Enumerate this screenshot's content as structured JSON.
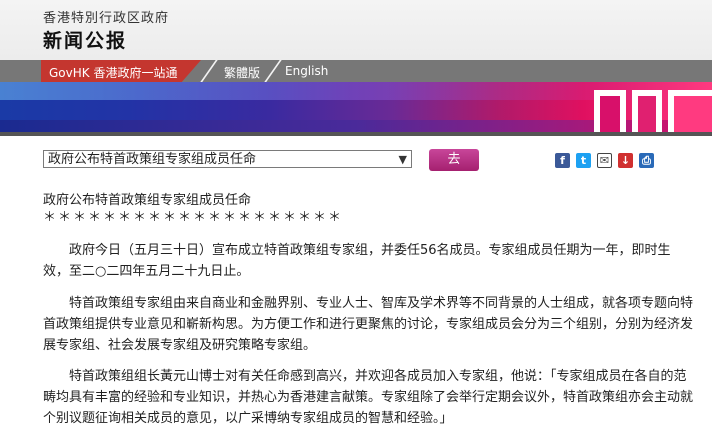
{
  "header": {
    "site_title": "香港特別行政区政府",
    "page_name": "新闻公报"
  },
  "nav": {
    "gov_label": "GovHK 香港政府一站通",
    "traditional_label": "繁體版",
    "english_label": "English"
  },
  "toolbar": {
    "selected_option": "政府公布特首政策组专家组成员任命",
    "go_label": "去",
    "dropdown_arrow": "▼"
  },
  "share": {
    "icons": [
      "facebook-icon",
      "twitter-icon",
      "email-icon",
      "download-icon",
      "print-icon"
    ],
    "colors": {
      "facebook": "#3b5998",
      "twitter": "#1da1f2",
      "email": "#444444",
      "download": "#d03030",
      "print": "#2a6ab8"
    }
  },
  "article": {
    "title": "政府公布特首政策组专家组成员任命",
    "stars": "＊＊＊＊＊＊＊＊＊＊＊＊＊＊＊＊＊＊＊＊",
    "paragraphs": [
      "政府今日（五月三十日）宣布成立特首政策组专家组，并委任56名成员。专家组成员任期为一年，即时生效，至二○二四年五月二十九日止。",
      "特首政策组专家组由来自商业和金融界别、专业人士、智库及学术界等不同背景的人士组成，就各项专题向特首政策组提供专业意见和嶄新构思。为方便工作和进行更聚焦的讨论，专家组成员会分为三个组别，分别为经济发展专家组、社会发展专家组及研究策略专家组。",
      "特首政策组组长黃元山博士对有关任命感到高兴，并欢迎各成员加入专家组，他说：「专家组成员在各自的范畴均具有丰富的经验和专业知识，并热心为香港建言献策。专家组除了会举行定期会议外，特首政策组亦会主动就个别议题征询相关成员的意见，以广采博纳专家组成员的智慧和经验。」"
    ]
  },
  "colors": {
    "accent": "#c4362f",
    "button": "#b5307e"
  }
}
